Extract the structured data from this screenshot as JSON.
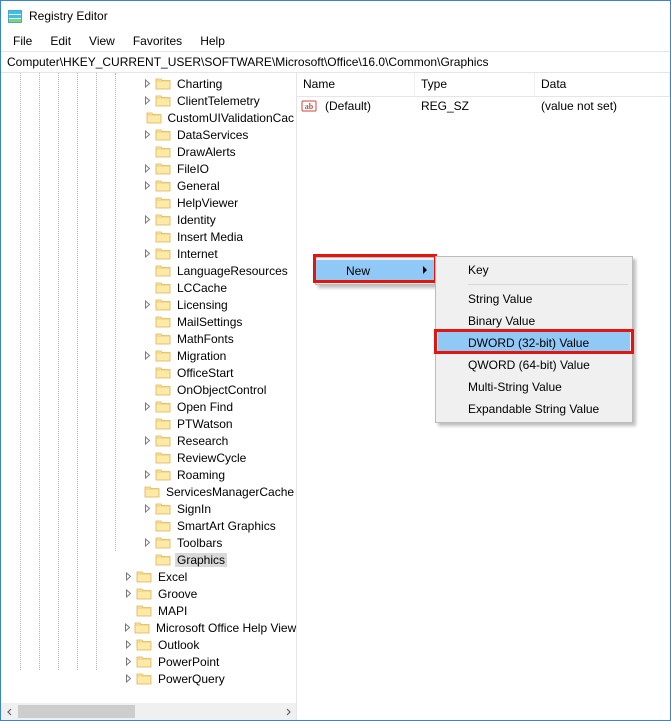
{
  "window": {
    "title": "Registry Editor"
  },
  "menus": {
    "file": "File",
    "edit": "Edit",
    "view": "View",
    "favorites": "Favorites",
    "help": "Help"
  },
  "address": "Computer\\HKEY_CURRENT_USER\\SOFTWARE\\Microsoft\\Office\\16.0\\Common\\Graphics",
  "tree": {
    "items": [
      {
        "indent": 7,
        "exp": "closed",
        "label": "Charting"
      },
      {
        "indent": 7,
        "exp": "closed",
        "label": "ClientTelemetry"
      },
      {
        "indent": 7,
        "exp": "none",
        "label": "CustomUIValidationCac"
      },
      {
        "indent": 7,
        "exp": "closed",
        "label": "DataServices"
      },
      {
        "indent": 7,
        "exp": "none",
        "label": "DrawAlerts"
      },
      {
        "indent": 7,
        "exp": "closed",
        "label": "FileIO"
      },
      {
        "indent": 7,
        "exp": "closed",
        "label": "General"
      },
      {
        "indent": 7,
        "exp": "none",
        "label": "HelpViewer"
      },
      {
        "indent": 7,
        "exp": "closed",
        "label": "Identity"
      },
      {
        "indent": 7,
        "exp": "none",
        "label": "Insert Media"
      },
      {
        "indent": 7,
        "exp": "closed",
        "label": "Internet"
      },
      {
        "indent": 7,
        "exp": "none",
        "label": "LanguageResources"
      },
      {
        "indent": 7,
        "exp": "none",
        "label": "LCCache"
      },
      {
        "indent": 7,
        "exp": "closed",
        "label": "Licensing"
      },
      {
        "indent": 7,
        "exp": "none",
        "label": "MailSettings"
      },
      {
        "indent": 7,
        "exp": "none",
        "label": "MathFonts"
      },
      {
        "indent": 7,
        "exp": "closed",
        "label": "Migration"
      },
      {
        "indent": 7,
        "exp": "none",
        "label": "OfficeStart"
      },
      {
        "indent": 7,
        "exp": "none",
        "label": "OnObjectControl"
      },
      {
        "indent": 7,
        "exp": "closed",
        "label": "Open Find"
      },
      {
        "indent": 7,
        "exp": "none",
        "label": "PTWatson"
      },
      {
        "indent": 7,
        "exp": "closed",
        "label": "Research"
      },
      {
        "indent": 7,
        "exp": "none",
        "label": "ReviewCycle"
      },
      {
        "indent": 7,
        "exp": "closed",
        "label": "Roaming"
      },
      {
        "indent": 7,
        "exp": "none",
        "label": "ServicesManagerCache"
      },
      {
        "indent": 7,
        "exp": "closed",
        "label": "SignIn"
      },
      {
        "indent": 7,
        "exp": "none",
        "label": "SmartArt Graphics"
      },
      {
        "indent": 7,
        "exp": "closed",
        "label": "Toolbars"
      },
      {
        "indent": 7,
        "exp": "none",
        "label": "Graphics",
        "selected": true
      },
      {
        "indent": 6,
        "exp": "closed",
        "label": "Excel"
      },
      {
        "indent": 6,
        "exp": "closed",
        "label": "Groove"
      },
      {
        "indent": 6,
        "exp": "none",
        "label": "MAPI"
      },
      {
        "indent": 6,
        "exp": "closed",
        "label": "Microsoft Office Help View"
      },
      {
        "indent": 6,
        "exp": "closed",
        "label": "Outlook"
      },
      {
        "indent": 6,
        "exp": "closed",
        "label": "PowerPoint"
      },
      {
        "indent": 6,
        "exp": "closed",
        "label": "PowerQuery"
      }
    ]
  },
  "list": {
    "headers": {
      "name": "Name",
      "type": "Type",
      "data": "Data"
    },
    "rows": [
      {
        "name": "(Default)",
        "type": "REG_SZ",
        "data": "(value not set)"
      }
    ]
  },
  "context": {
    "parent": {
      "new": "New"
    },
    "sub": {
      "key": "Key",
      "string": "String Value",
      "binary": "Binary Value",
      "dword": "DWORD (32-bit) Value",
      "qword": "QWORD (64-bit) Value",
      "multi": "Multi-String Value",
      "expand": "Expandable String Value"
    }
  }
}
